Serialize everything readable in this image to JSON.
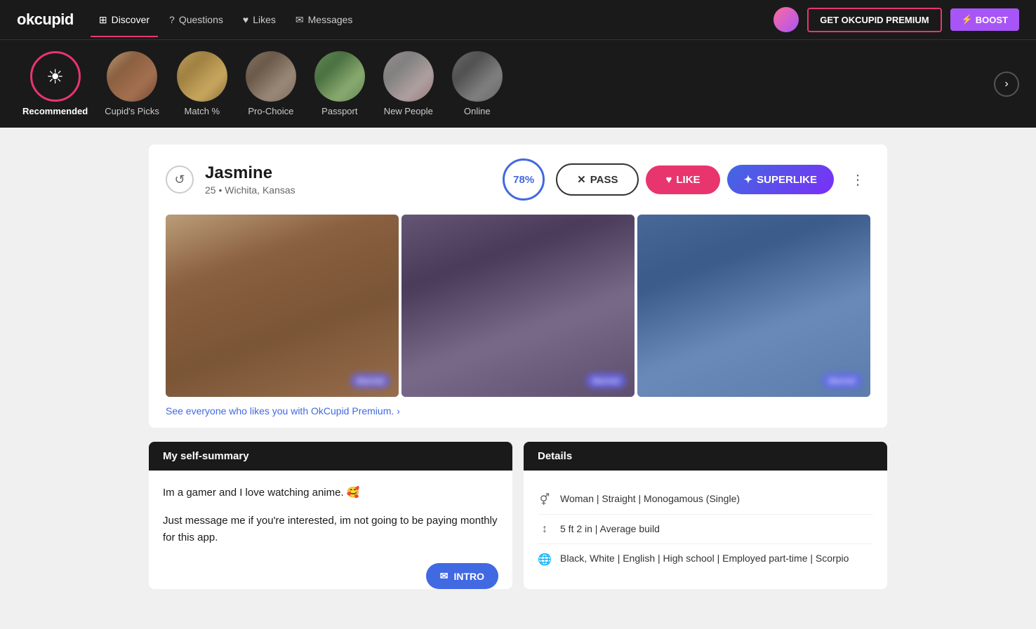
{
  "app": {
    "logo": "okcupid",
    "colors": {
      "primary": "#e8356e",
      "secondary": "#4169e1",
      "superlike": "#7b2ff7",
      "dark_bg": "#1a1a1a",
      "accent_purple": "#a855f7"
    }
  },
  "header": {
    "nav": [
      {
        "id": "discover",
        "label": "Discover",
        "active": true,
        "icon": "⊞"
      },
      {
        "id": "questions",
        "label": "Questions",
        "active": false,
        "icon": "?"
      },
      {
        "id": "likes",
        "label": "Likes",
        "active": false,
        "icon": "♥"
      },
      {
        "id": "messages",
        "label": "Messages",
        "active": false,
        "icon": "✉"
      }
    ],
    "premium_btn": "GET OKCUPID PREMIUM",
    "boost_btn": "BOOST",
    "boost_icon": "⚡"
  },
  "categories": [
    {
      "id": "recommended",
      "label": "Recommended",
      "active": true
    },
    {
      "id": "cupids-picks",
      "label": "Cupid's Picks",
      "active": false
    },
    {
      "id": "match",
      "label": "Match %",
      "active": false
    },
    {
      "id": "pro-choice",
      "label": "Pro-Choice",
      "active": false
    },
    {
      "id": "passport",
      "label": "Passport",
      "active": false
    },
    {
      "id": "new-people",
      "label": "New People",
      "active": false
    },
    {
      "id": "online",
      "label": "Online",
      "active": false
    }
  ],
  "profile": {
    "name": "Jasmine",
    "age": "25",
    "location": "Wichita, Kansas",
    "match_percent": "78%",
    "buttons": {
      "pass": "PASS",
      "like": "LIKE",
      "superlike": "SUPERLIKE"
    },
    "premium_link": "See everyone who likes you with OkCupid Premium.",
    "summary": {
      "header": "My self-summary",
      "text1": "Im a gamer and I love watching anime. 🥰",
      "text2": "Just message me if you're interested, im not going to be paying monthly for this app."
    },
    "details": {
      "header": "Details",
      "items": [
        {
          "icon": "gender",
          "text": "Woman | Straight | Monogamous (Single)"
        },
        {
          "icon": "height",
          "text": "5 ft 2 in | Average build"
        },
        {
          "icon": "globe",
          "text": "Black, White | English | High school | Employed part-time | Scorpio"
        }
      ]
    },
    "intro_btn": "INTRO"
  },
  "controls": {
    "undo_label": "undo",
    "next_label": "next"
  }
}
